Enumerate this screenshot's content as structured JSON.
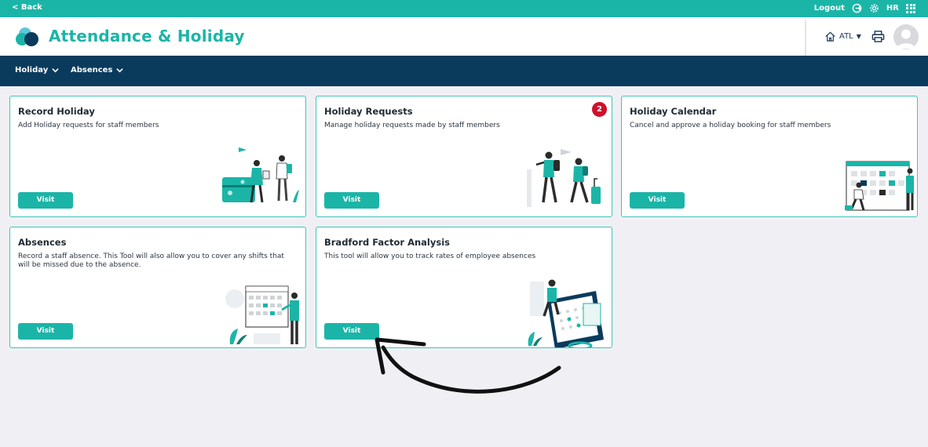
{
  "topbar": {
    "back_label": "< Back",
    "logout_label": "Logout",
    "hr_label": "HR"
  },
  "header": {
    "title": "Attendance & Holiday",
    "site_label": "ATL"
  },
  "nav": {
    "items": [
      {
        "label": "Holiday"
      },
      {
        "label": "Absences"
      }
    ]
  },
  "cards": [
    {
      "title": "Record Holiday",
      "description": "Add Holiday requests for staff members",
      "button": "Visit",
      "illustration": "travel-couple-illustration"
    },
    {
      "title": "Holiday Requests",
      "description": "Manage holiday requests made by staff members",
      "button": "Visit",
      "badge": "2",
      "illustration": "travellers-illustration"
    },
    {
      "title": "Holiday Calendar",
      "description": "Cancel and approve a holiday booking for staff members",
      "button": "Visit",
      "illustration": "calendar-people-illustration"
    },
    {
      "title": "Absences",
      "description": "Record a staff absence. This Tool will also allow you to cover any shifts that will be missed due to the absence.",
      "button": "Visit",
      "illustration": "calendar-woman-illustration"
    },
    {
      "title": "Bradford Factor Analysis",
      "description": "This tool will allow you to track rates of employee absences",
      "button": "Visit",
      "illustration": "tablet-analysis-illustration"
    }
  ],
  "colors": {
    "primary": "#1bb5a8",
    "nav_bg": "#0a3b5c",
    "badge": "#d0102b",
    "page_bg": "#f0f0f4"
  }
}
